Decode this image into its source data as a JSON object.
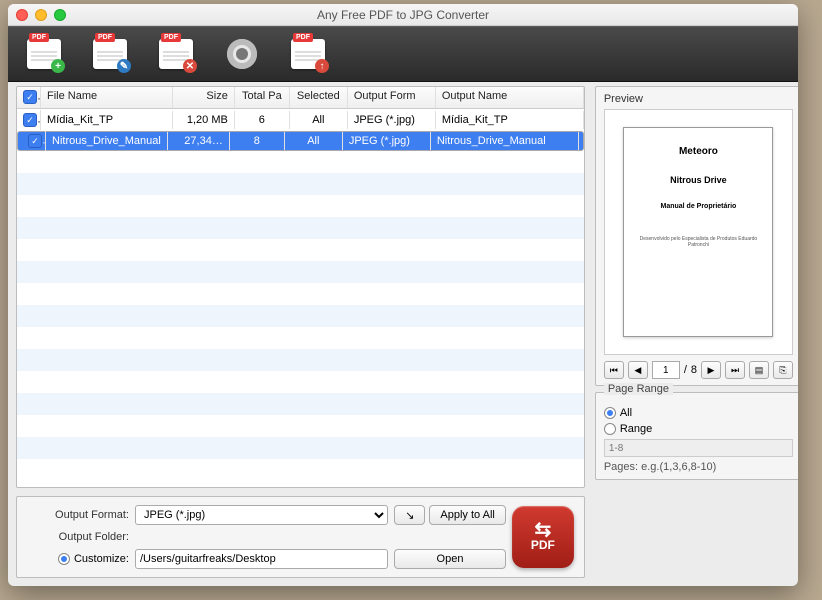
{
  "window": {
    "title": "Any Free PDF to JPG Converter"
  },
  "toolbar": {
    "add": "add-pdf",
    "edit": "edit-pdf",
    "remove": "remove-pdf",
    "settings": "settings",
    "upload": "upload-pdf"
  },
  "columns": {
    "check": "",
    "name": "File Name",
    "size": "Size",
    "totalPages": "Total Pa",
    "selected": "Selected",
    "outFormat": "Output Form",
    "outName": "Output Name"
  },
  "files": [
    {
      "checked": true,
      "selected": false,
      "name": "Mídia_Kit_TP",
      "size": "1,20 MB",
      "totalPages": "6",
      "selectedPages": "All",
      "outFormat": "JPEG (*.jpg)",
      "outName": "Mídia_Kit_TP"
    },
    {
      "checked": true,
      "selected": true,
      "name": "Nitrous_Drive_Manual",
      "size": "27,34…",
      "totalPages": "8",
      "selectedPages": "All",
      "outFormat": "JPEG (*.jpg)",
      "outName": "Nitrous_Drive_Manual"
    }
  ],
  "output": {
    "formatLabel": "Output Format:",
    "formatValue": "JPEG (*.jpg)",
    "applyAll": "Apply to All",
    "folderLabel": "Output Folder:",
    "customizeLabel": "Customize:",
    "customizeSelected": true,
    "path": "/Users/guitarfreaks/Desktop",
    "open": "Open",
    "convertLabel": "PDF"
  },
  "preview": {
    "label": "Preview",
    "page": {
      "t1": "Meteoro",
      "t2": "Nitrous Drive",
      "t3": "Manual de Proprietário",
      "t4": "Desenvolvido pelo Especialista de Produtos Eduardo Patronchi"
    },
    "pager": {
      "current": "1",
      "sep": "/",
      "total": "8"
    }
  },
  "pageRange": {
    "label": "Page Range",
    "allLabel": "All",
    "rangeLabel": "Range",
    "allSelected": true,
    "placeholder": "1-8",
    "hint": "Pages: e.g.(1,3,6,8-10)"
  }
}
